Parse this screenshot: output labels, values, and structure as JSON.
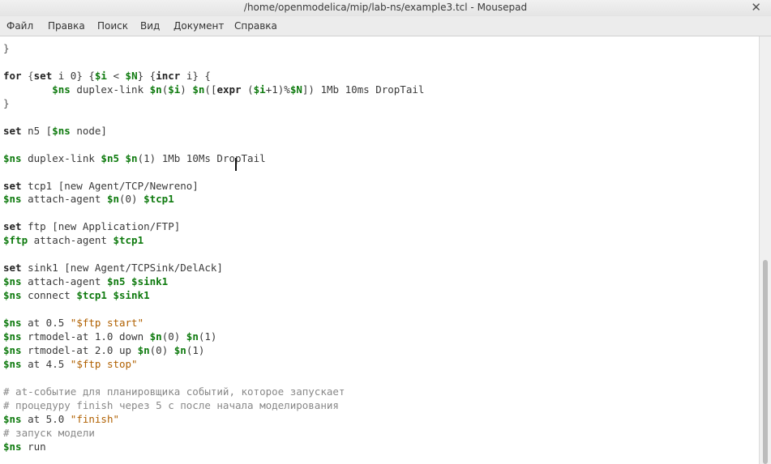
{
  "window": {
    "title": "/home/openmodelica/mip/lab-ns/example3.tcl - Mousepad",
    "close_glyph": "✕"
  },
  "menu": [
    "Файл",
    "Правка",
    "Поиск",
    "Вид",
    "Документ",
    "Справка"
  ],
  "editor": {
    "lines": [
      [
        {
          "t": "}",
          "c": "brk"
        }
      ],
      [],
      [
        {
          "t": "for",
          "c": "kw"
        },
        {
          "t": " {",
          "c": "brk"
        },
        {
          "t": "set",
          "c": "kw"
        },
        {
          "t": " i 0} {",
          "c": ""
        },
        {
          "t": "$i",
          "c": "var"
        },
        {
          "t": " < ",
          "c": ""
        },
        {
          "t": "$N",
          "c": "var"
        },
        {
          "t": "} {",
          "c": ""
        },
        {
          "t": "incr",
          "c": "kw"
        },
        {
          "t": " i} {",
          "c": ""
        }
      ],
      [
        {
          "t": "        ",
          "c": ""
        },
        {
          "t": "$ns",
          "c": "var"
        },
        {
          "t": " duplex-link ",
          "c": ""
        },
        {
          "t": "$n",
          "c": "var"
        },
        {
          "t": "(",
          "c": ""
        },
        {
          "t": "$i",
          "c": "var"
        },
        {
          "t": ") ",
          "c": ""
        },
        {
          "t": "$n",
          "c": "var"
        },
        {
          "t": "([",
          "c": ""
        },
        {
          "t": "expr",
          "c": "kw"
        },
        {
          "t": " (",
          "c": ""
        },
        {
          "t": "$i",
          "c": "var"
        },
        {
          "t": "+1)%",
          "c": ""
        },
        {
          "t": "$N",
          "c": "var"
        },
        {
          "t": "]) 1Mb 10ms DropTail",
          "c": ""
        }
      ],
      [
        {
          "t": "}",
          "c": "brk"
        }
      ],
      [],
      [
        {
          "t": "set",
          "c": "kw"
        },
        {
          "t": " n5 [",
          "c": ""
        },
        {
          "t": "$ns",
          "c": "var"
        },
        {
          "t": " node]",
          "c": ""
        }
      ],
      [],
      [
        {
          "t": "$ns",
          "c": "var"
        },
        {
          "t": " duplex-link ",
          "c": ""
        },
        {
          "t": "$n5",
          "c": "var"
        },
        {
          "t": " ",
          "c": ""
        },
        {
          "t": "$n",
          "c": "var"
        },
        {
          "t": "(1) 1Mb 10Ms DropTail",
          "c": ""
        }
      ],
      [],
      [
        {
          "t": "set",
          "c": "kw"
        },
        {
          "t": " tcp1 [new Agent/TCP/Newreno]",
          "c": ""
        }
      ],
      [
        {
          "t": "$ns",
          "c": "var"
        },
        {
          "t": " attach-agent ",
          "c": ""
        },
        {
          "t": "$n",
          "c": "var"
        },
        {
          "t": "(0) ",
          "c": ""
        },
        {
          "t": "$tcp1",
          "c": "var"
        }
      ],
      [],
      [
        {
          "t": "set",
          "c": "kw"
        },
        {
          "t": " ftp [new Application/FTP]",
          "c": ""
        }
      ],
      [
        {
          "t": "$ftp",
          "c": "var"
        },
        {
          "t": " attach-agent ",
          "c": ""
        },
        {
          "t": "$tcp1",
          "c": "var"
        }
      ],
      [],
      [
        {
          "t": "set",
          "c": "kw"
        },
        {
          "t": " sink1 [new Agent/TCPSink/DelAck]",
          "c": ""
        }
      ],
      [
        {
          "t": "$ns",
          "c": "var"
        },
        {
          "t": " attach-agent ",
          "c": ""
        },
        {
          "t": "$n5",
          "c": "var"
        },
        {
          "t": " ",
          "c": ""
        },
        {
          "t": "$sink1",
          "c": "var"
        }
      ],
      [
        {
          "t": "$ns",
          "c": "var"
        },
        {
          "t": " connect ",
          "c": ""
        },
        {
          "t": "$tcp1",
          "c": "var"
        },
        {
          "t": " ",
          "c": ""
        },
        {
          "t": "$sink1",
          "c": "var"
        }
      ],
      [],
      [
        {
          "t": "$ns",
          "c": "var"
        },
        {
          "t": " at 0.5 ",
          "c": ""
        },
        {
          "t": "\"$ftp start\"",
          "c": "str"
        }
      ],
      [
        {
          "t": "$ns",
          "c": "var"
        },
        {
          "t": " rtmodel-at 1.0 down ",
          "c": ""
        },
        {
          "t": "$n",
          "c": "var"
        },
        {
          "t": "(0) ",
          "c": ""
        },
        {
          "t": "$n",
          "c": "var"
        },
        {
          "t": "(1)",
          "c": ""
        }
      ],
      [
        {
          "t": "$ns",
          "c": "var"
        },
        {
          "t": " rtmodel-at 2.0 up ",
          "c": ""
        },
        {
          "t": "$n",
          "c": "var"
        },
        {
          "t": "(0) ",
          "c": ""
        },
        {
          "t": "$n",
          "c": "var"
        },
        {
          "t": "(1)",
          "c": ""
        }
      ],
      [
        {
          "t": "$ns",
          "c": "var"
        },
        {
          "t": " at 4.5 ",
          "c": ""
        },
        {
          "t": "\"$ftp stop\"",
          "c": "str"
        }
      ],
      [],
      [
        {
          "t": "# at-событие для планировщика событий, которое запускает",
          "c": "cmt"
        }
      ],
      [
        {
          "t": "# процедуру finish через 5 с после начала моделирования",
          "c": "cmt"
        }
      ],
      [
        {
          "t": "$ns",
          "c": "var"
        },
        {
          "t": " at 5.0 ",
          "c": ""
        },
        {
          "t": "\"finish\"",
          "c": "str"
        }
      ],
      [
        {
          "t": "# запуск модели",
          "c": "cmt"
        }
      ],
      [
        {
          "t": "$ns",
          "c": "var"
        },
        {
          "t": " run",
          "c": ""
        }
      ]
    ]
  }
}
